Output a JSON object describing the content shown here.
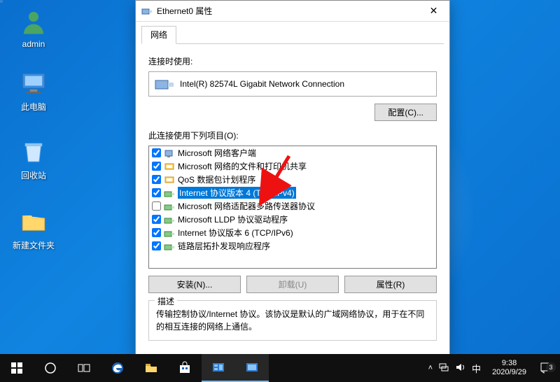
{
  "desktop": {
    "icons": [
      {
        "label": "admin"
      },
      {
        "label": "此电脑"
      },
      {
        "label": "回收站"
      },
      {
        "label": "新建文件夹"
      }
    ]
  },
  "dialog": {
    "title": "Ethernet0 属性",
    "tab": "网络",
    "connect_using_label": "连接时使用:",
    "adapter": "Intel(R) 82574L Gigabit Network Connection",
    "configure_button": "配置(C)...",
    "items_label": "此连接使用下列项目(O):",
    "components": [
      {
        "checked": true,
        "icon": "client",
        "label": "Microsoft 网络客户端",
        "selected": false
      },
      {
        "checked": true,
        "icon": "service",
        "label": "Microsoft 网络的文件和打印机共享",
        "selected": false
      },
      {
        "checked": true,
        "icon": "service",
        "label": "QoS 数据包计划程序",
        "selected": false
      },
      {
        "checked": true,
        "icon": "protocol",
        "label": "Internet 协议版本 4 (TCP/IPv4)",
        "selected": true
      },
      {
        "checked": false,
        "icon": "protocol",
        "label": "Microsoft 网络适配器多路传送器协议",
        "selected": false
      },
      {
        "checked": true,
        "icon": "protocol",
        "label": "Microsoft LLDP 协议驱动程序",
        "selected": false
      },
      {
        "checked": true,
        "icon": "protocol",
        "label": "Internet 协议版本 6 (TCP/IPv6)",
        "selected": false
      },
      {
        "checked": true,
        "icon": "protocol",
        "label": "链路层拓扑发现响应程序",
        "selected": false
      }
    ],
    "install_button": "安装(N)...",
    "uninstall_button": "卸载(U)",
    "properties_button": "属性(R)",
    "description_title": "描述",
    "description_text": "传输控制协议/Internet 协议。该协议是默认的广域网络协议，用于在不同的相互连接的网络上通信。"
  },
  "taskbar": {
    "ime": "中",
    "time": "9:38",
    "date": "2020/9/29",
    "notif_count": "3"
  }
}
